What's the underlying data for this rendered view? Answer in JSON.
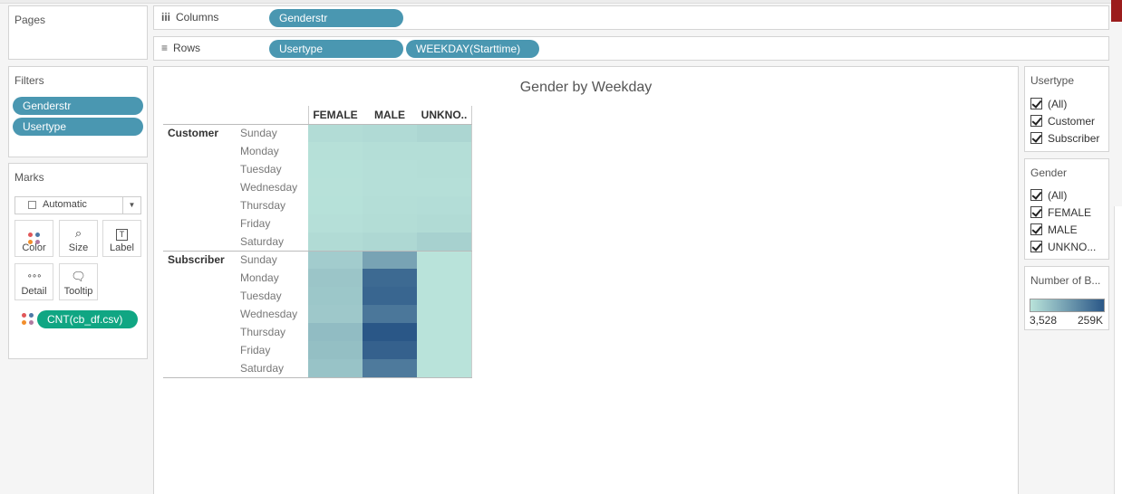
{
  "pages": {
    "title": "Pages"
  },
  "shelves": {
    "columns": {
      "label": "Columns",
      "icon": "iii",
      "pills": [
        "Genderstr"
      ]
    },
    "rows": {
      "label": "Rows",
      "icon": "≡",
      "pills": [
        "Usertype",
        "WEEKDAY(Starttime)"
      ]
    }
  },
  "filters": {
    "title": "Filters",
    "pills": [
      "Genderstr",
      "Usertype"
    ]
  },
  "marks": {
    "title": "Marks",
    "type": "Automatic",
    "buttons": {
      "color": "Color",
      "size": "Size",
      "label": "Label",
      "detail": "Detail",
      "tooltip": "Tooltip"
    },
    "field": "CNT(cb_df.csv)"
  },
  "sheet": {
    "title": "Gender by Weekday",
    "columns": [
      "FEMALE",
      "MALE",
      "UNKNO.."
    ],
    "groups": [
      {
        "name": "Customer",
        "days": [
          "Sunday",
          "Monday",
          "Tuesday",
          "Wednesday",
          "Thursday",
          "Friday",
          "Saturday"
        ]
      },
      {
        "name": "Subscriber",
        "days": [
          "Sunday",
          "Monday",
          "Tuesday",
          "Wednesday",
          "Thursday",
          "Friday",
          "Saturday"
        ]
      }
    ]
  },
  "chart_data": {
    "type": "heatmap",
    "title": "Gender by Weekday",
    "x_categories": [
      "FEMALE",
      "MALE",
      "UNKNO.."
    ],
    "y_groups": [
      "Customer",
      "Subscriber"
    ],
    "y_categories": [
      "Sunday",
      "Monday",
      "Tuesday",
      "Wednesday",
      "Thursday",
      "Friday",
      "Saturday"
    ],
    "color_range": [
      3528,
      259000
    ],
    "values": [
      [
        16000,
        20000,
        27000
      ],
      [
        9000,
        12000,
        13000
      ],
      [
        8000,
        11000,
        12000
      ],
      [
        7000,
        10000,
        11000
      ],
      [
        8000,
        12000,
        14000
      ],
      [
        10000,
        15000,
        18000
      ],
      [
        18000,
        24000,
        36000
      ],
      [
        45000,
        120000,
        4000
      ],
      [
        58000,
        225000,
        3600
      ],
      [
        55000,
        232000,
        3600
      ],
      [
        52000,
        200000,
        3600
      ],
      [
        75000,
        259000,
        3528
      ],
      [
        70000,
        240000,
        3600
      ],
      [
        62000,
        195000,
        4000
      ]
    ]
  },
  "legends": {
    "usertype": {
      "title": "Usertype",
      "items": [
        "(All)",
        "Customer",
        "Subscriber"
      ]
    },
    "gender": {
      "title": "Gender",
      "items": [
        "(All)",
        "FEMALE",
        "MALE",
        "UNKNO..."
      ]
    },
    "number": {
      "title": "Number of B...",
      "min_label": "3,528",
      "max_label": "259K"
    }
  },
  "colors": {
    "pill_blue": "#4a97b1",
    "pill_green": "#10a683",
    "scale_low": "#b9e3da",
    "scale_high": "#2a5787"
  }
}
